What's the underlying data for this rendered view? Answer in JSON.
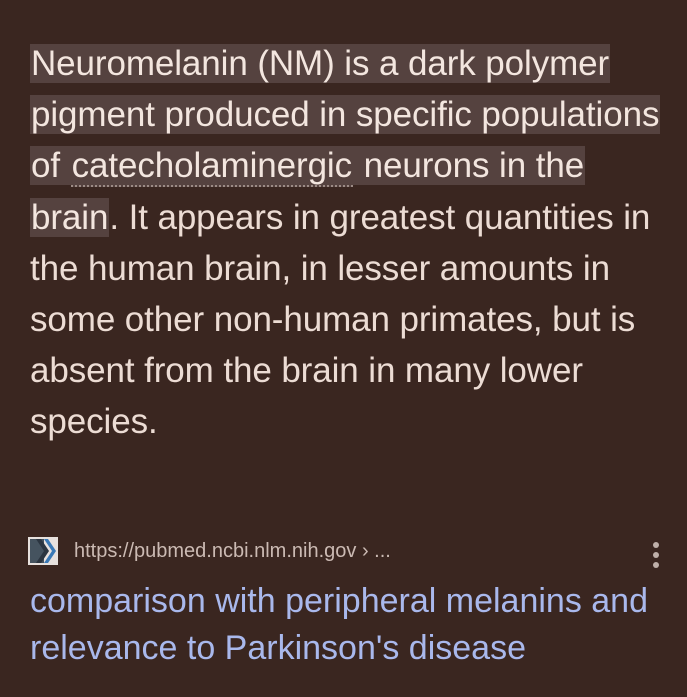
{
  "snippet": {
    "hl1": "Neuromelanin (NM) is a dark polymer pigment produced in specific populations of ",
    "hl_term": "catecholaminergic",
    "hl2": " neurons in the brain",
    "rest": ". It appears in greatest quantities in the human brain, in lesser amounts in some other non-human primates, but is absent from the brain in many lower species."
  },
  "source": {
    "url": "https://pubmed.ncbi.nlm.nih.gov › ...",
    "favicon": "pubmed-logo-icon",
    "more_icon": "more-vert-icon"
  },
  "result": {
    "title": "comparison with peripheral melanins and relevance to Parkinson's disease"
  },
  "colors": {
    "background": "#3a2620",
    "highlight": "#55423f",
    "text": "#ecdcd4",
    "link": "#a9b8ec"
  }
}
